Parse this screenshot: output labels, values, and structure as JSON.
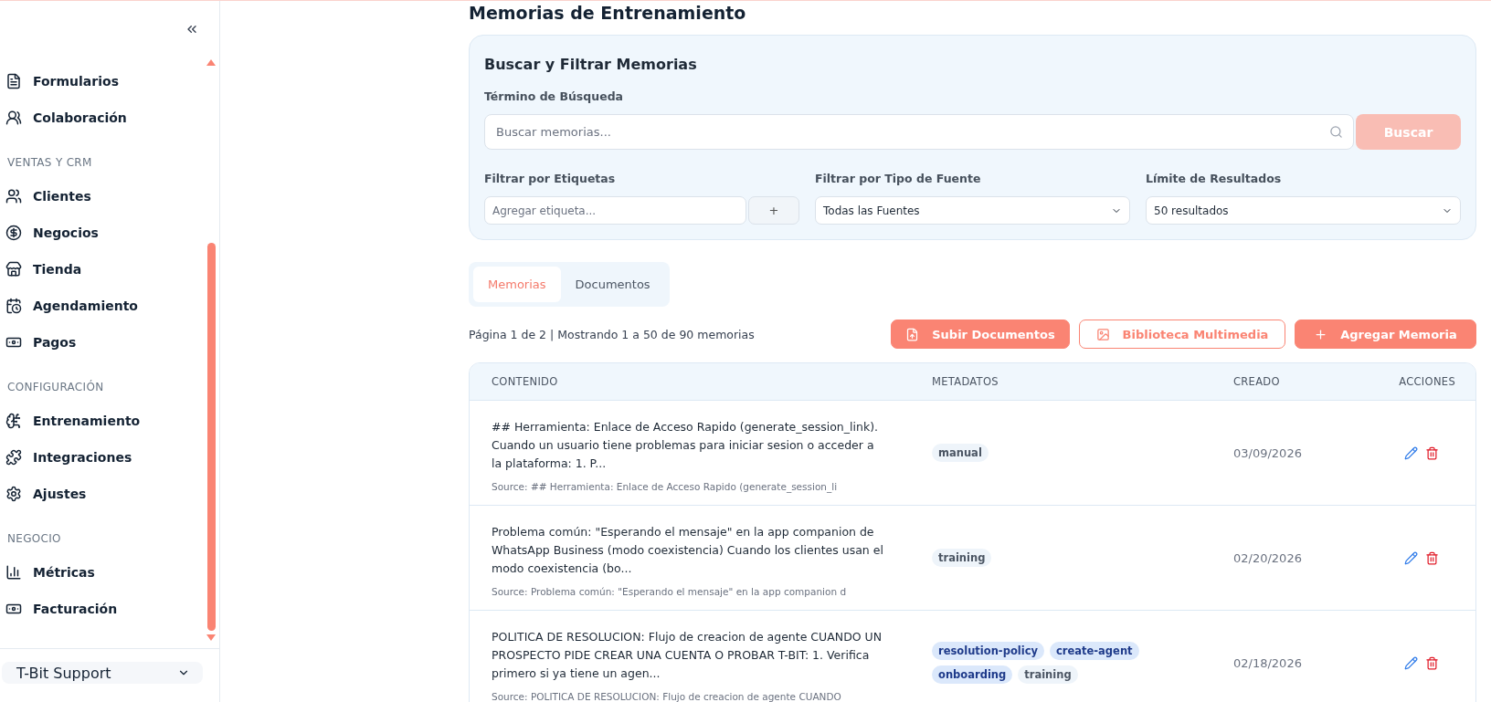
{
  "sidebar": {
    "sections": [
      {
        "items": [
          {
            "label": "Formularios"
          },
          {
            "label": "Colaboración"
          }
        ]
      },
      {
        "heading": "VENTAS Y CRM",
        "items": [
          {
            "label": "Clientes"
          },
          {
            "label": "Negocios"
          },
          {
            "label": "Tienda"
          },
          {
            "label": "Agendamiento"
          },
          {
            "label": "Pagos"
          }
        ]
      },
      {
        "heading": "CONFIGURACIÓN",
        "items": [
          {
            "label": "Entrenamiento"
          },
          {
            "label": "Integraciones"
          },
          {
            "label": "Ajustes"
          }
        ]
      },
      {
        "heading": "NEGOCIO",
        "items": [
          {
            "label": "Métricas"
          },
          {
            "label": "Facturación"
          }
        ]
      }
    ],
    "account": "T-Bit Support"
  },
  "page_title": "Memorias de Entrenamiento",
  "filters": {
    "title": "Buscar y Filtrar Memorias",
    "search_label": "Término de Búsqueda",
    "search_placeholder": "Buscar memorias...",
    "search_button": "Buscar",
    "tags_label": "Filtrar por Etiquetas",
    "tags_placeholder": "Agregar etiqueta...",
    "add_tag_button": "+",
    "source_label": "Filtrar por Tipo de Fuente",
    "source_value": "Todas las Fuentes",
    "limit_label": "Límite de Resultados",
    "limit_value": "50 resultados"
  },
  "tabs": [
    {
      "label": "Memorias",
      "selected": true
    },
    {
      "label": "Documentos",
      "selected": false
    }
  ],
  "pagination": "Página 1 de 2 | Mostrando 1 a 50 de 90 memorias",
  "actions": [
    {
      "kind": "upload",
      "label": "Subir Documentos"
    },
    {
      "kind": "media",
      "label": "Biblioteca Multimedia"
    },
    {
      "kind": "add",
      "label": "Agregar Memoria"
    }
  ],
  "table": {
    "columns": [
      "CONTENIDO",
      "METADATOS",
      "CREADO",
      "ACCIONES"
    ],
    "rows": [
      {
        "content": "## Herramienta: Enlace de Acceso Rapido (generate_session_link). Cuando un usuario tiene problemas para iniciar sesion o acceder a la plataforma: 1. P...",
        "source": "Source: ## Herramienta: Enlace de Acceso Rapido (generate_session_li",
        "tags": [
          {
            "label": "manual",
            "color": "#eef4fa"
          }
        ],
        "created": "03/09/2026"
      },
      {
        "content": "Problema común: \"Esperando el mensaje\" en la app companion de WhatsApp Business (modo coexistencia) Cuando los clientes usan el modo coexistencia (bo...",
        "source": "Source: Problema común: \"Esperando el mensaje\" en la app companion d",
        "tags": [
          {
            "label": "training",
            "color": "#eef4fa"
          }
        ],
        "created": "02/20/2026"
      },
      {
        "content": "POLITICA DE RESOLUCION: Flujo de creacion de agente CUANDO UN PROSPECTO PIDE CREAR UNA CUENTA O PROBAR T-BIT: 1. Verifica primero si ya tiene un agen...",
        "source": "Source: POLITICA DE RESOLUCION: Flujo de creacion de agente CUANDO",
        "tags": [
          {
            "label": "resolution-policy",
            "color": "#dbe8fb"
          },
          {
            "label": "create-agent",
            "color": "#dbe8fb"
          },
          {
            "label": "onboarding",
            "color": "#dbe8fb"
          },
          {
            "label": "training",
            "color": "#eef4fa"
          }
        ],
        "created": "02/18/2026"
      }
    ]
  }
}
